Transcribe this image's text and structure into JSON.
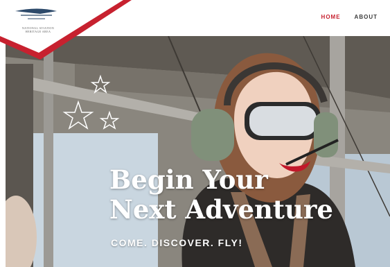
{
  "logo": {
    "name_line1": "NATIONAL AVIATION",
    "name_line2": "HERITAGE AREA"
  },
  "nav": {
    "items": [
      {
        "label": "HOME",
        "active": true
      },
      {
        "label": "ABOUT",
        "active": false
      }
    ]
  },
  "hero": {
    "headline_line1": "Begin Your",
    "headline_line2": "Next Adventure",
    "tagline": "COME. DISCOVER. FLY!"
  },
  "colors": {
    "accent": "#c7212f",
    "nav_text": "#3b3b3b"
  }
}
